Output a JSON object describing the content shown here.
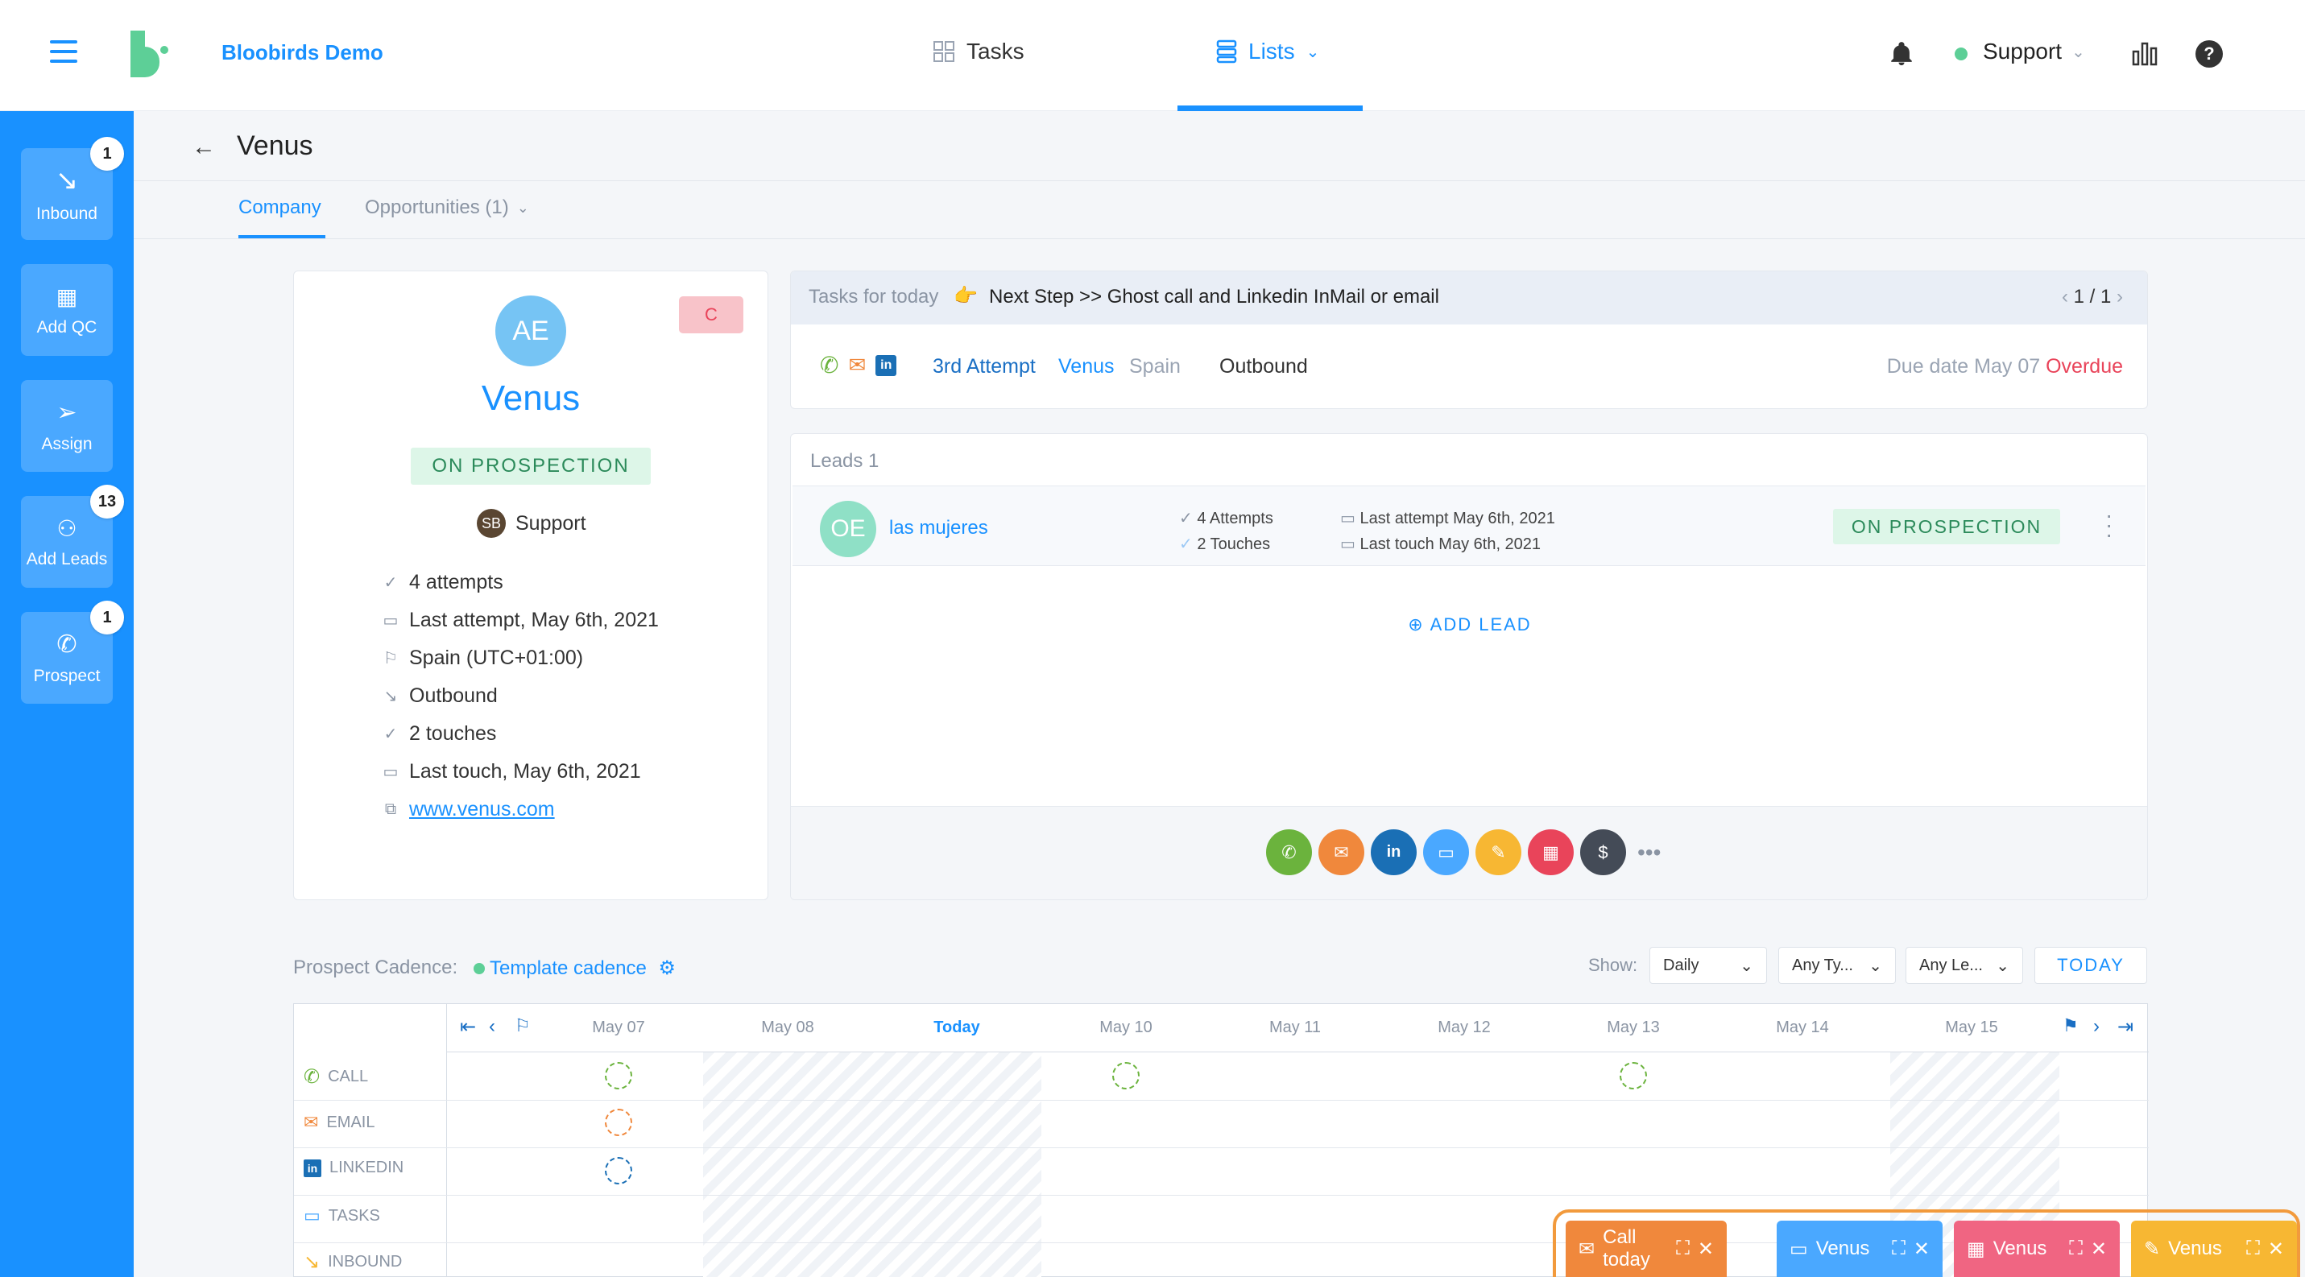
{
  "topbar": {
    "brand": "Bloobirds Demo",
    "nav": {
      "tasks": "Tasks",
      "lists": "Lists"
    },
    "user": "Support",
    "colors": {
      "accent": "#1991ff",
      "brand_green": "#5dcf97"
    }
  },
  "sidebar": {
    "items": [
      {
        "label": "Inbound",
        "badge": "1",
        "icon": "inbound-arrow-icon"
      },
      {
        "label": "Add QC",
        "badge": "",
        "icon": "building-icon"
      },
      {
        "label": "Assign",
        "badge": "",
        "icon": "send-icon"
      },
      {
        "label": "Add Leads",
        "badge": "13",
        "icon": "add-user-icon"
      },
      {
        "label": "Prospect",
        "badge": "1",
        "icon": "phone-icon"
      }
    ]
  },
  "header": {
    "title": "Venus",
    "tabs": {
      "company": "Company",
      "opportunities": "Opportunities (1)"
    }
  },
  "company": {
    "initials": "AE",
    "stage_badge": "C",
    "name": "Venus",
    "status": "ON PROSPECTION",
    "owner_initials": "SB",
    "owner": "Support",
    "details": {
      "attempts": "4 attempts",
      "last_attempt": "Last attempt, May 6th, 2021",
      "location": "Spain (UTC+01:00)",
      "source": "Outbound",
      "touches": "2 touches",
      "last_touch": "Last touch, May 6th, 2021",
      "website": "www.venus.com"
    }
  },
  "tasks": {
    "label": "Tasks for today",
    "emoji": "👉",
    "next_step": "Next Step >> Ghost call and Linkedin InMail  or email",
    "pager": "1 / 1",
    "attempt": "3rd Attempt",
    "company": "Venus",
    "country": "Spain",
    "source": "Outbound",
    "due_prefix": "Due date May 07",
    "due_status": "Overdue"
  },
  "leads": {
    "label": "Leads 1",
    "lead": {
      "initials": "OE",
      "name": "las mujeres",
      "attempts": "4 Attempts",
      "touches": "2 Touches",
      "last_attempt": "Last attempt May 6th, 2021",
      "last_touch": "Last touch May 6th, 2021",
      "status": "ON PROSPECTION"
    },
    "add_lead": "ADD LEAD"
  },
  "actions": [
    {
      "name": "call",
      "color": "#6bb33d",
      "glyph": "✆"
    },
    {
      "name": "email",
      "color": "#f0883c",
      "glyph": "✉"
    },
    {
      "name": "linkedin",
      "color": "#1a6fb5",
      "glyph": "in"
    },
    {
      "name": "task",
      "color": "#4aa8ff",
      "glyph": "▭"
    },
    {
      "name": "note",
      "color": "#f7b733",
      "glyph": "✎"
    },
    {
      "name": "calendar",
      "color": "#e9445a",
      "glyph": "▦"
    },
    {
      "name": "invoice",
      "color": "#444b57",
      "glyph": "$"
    }
  ],
  "cadence": {
    "label": "Prospect Cadence:",
    "template": "Template cadence",
    "show": "Show:",
    "filters": {
      "period": "Daily",
      "type": "Any Ty...",
      "lead": "Any Le..."
    },
    "today_btn": "TODAY",
    "days": [
      "May 07",
      "May 08",
      "Today",
      "May 10",
      "May 11",
      "May 12",
      "May 13",
      "May 14",
      "May 15"
    ],
    "rows": [
      "CALL",
      "EMAIL",
      "LINKEDIN",
      "TASKS",
      "INBOUND"
    ]
  },
  "bottom_tabs": [
    {
      "label": "Call today",
      "color": "#f0883c",
      "icon": "mail-icon"
    },
    {
      "label": "Venus",
      "color": "#4aa8ff",
      "icon": "window-icon"
    },
    {
      "label": "Venus",
      "color": "#f06582",
      "icon": "calendar-icon"
    },
    {
      "label": "Venus",
      "color": "#f7b733",
      "icon": "edit-icon"
    }
  ]
}
